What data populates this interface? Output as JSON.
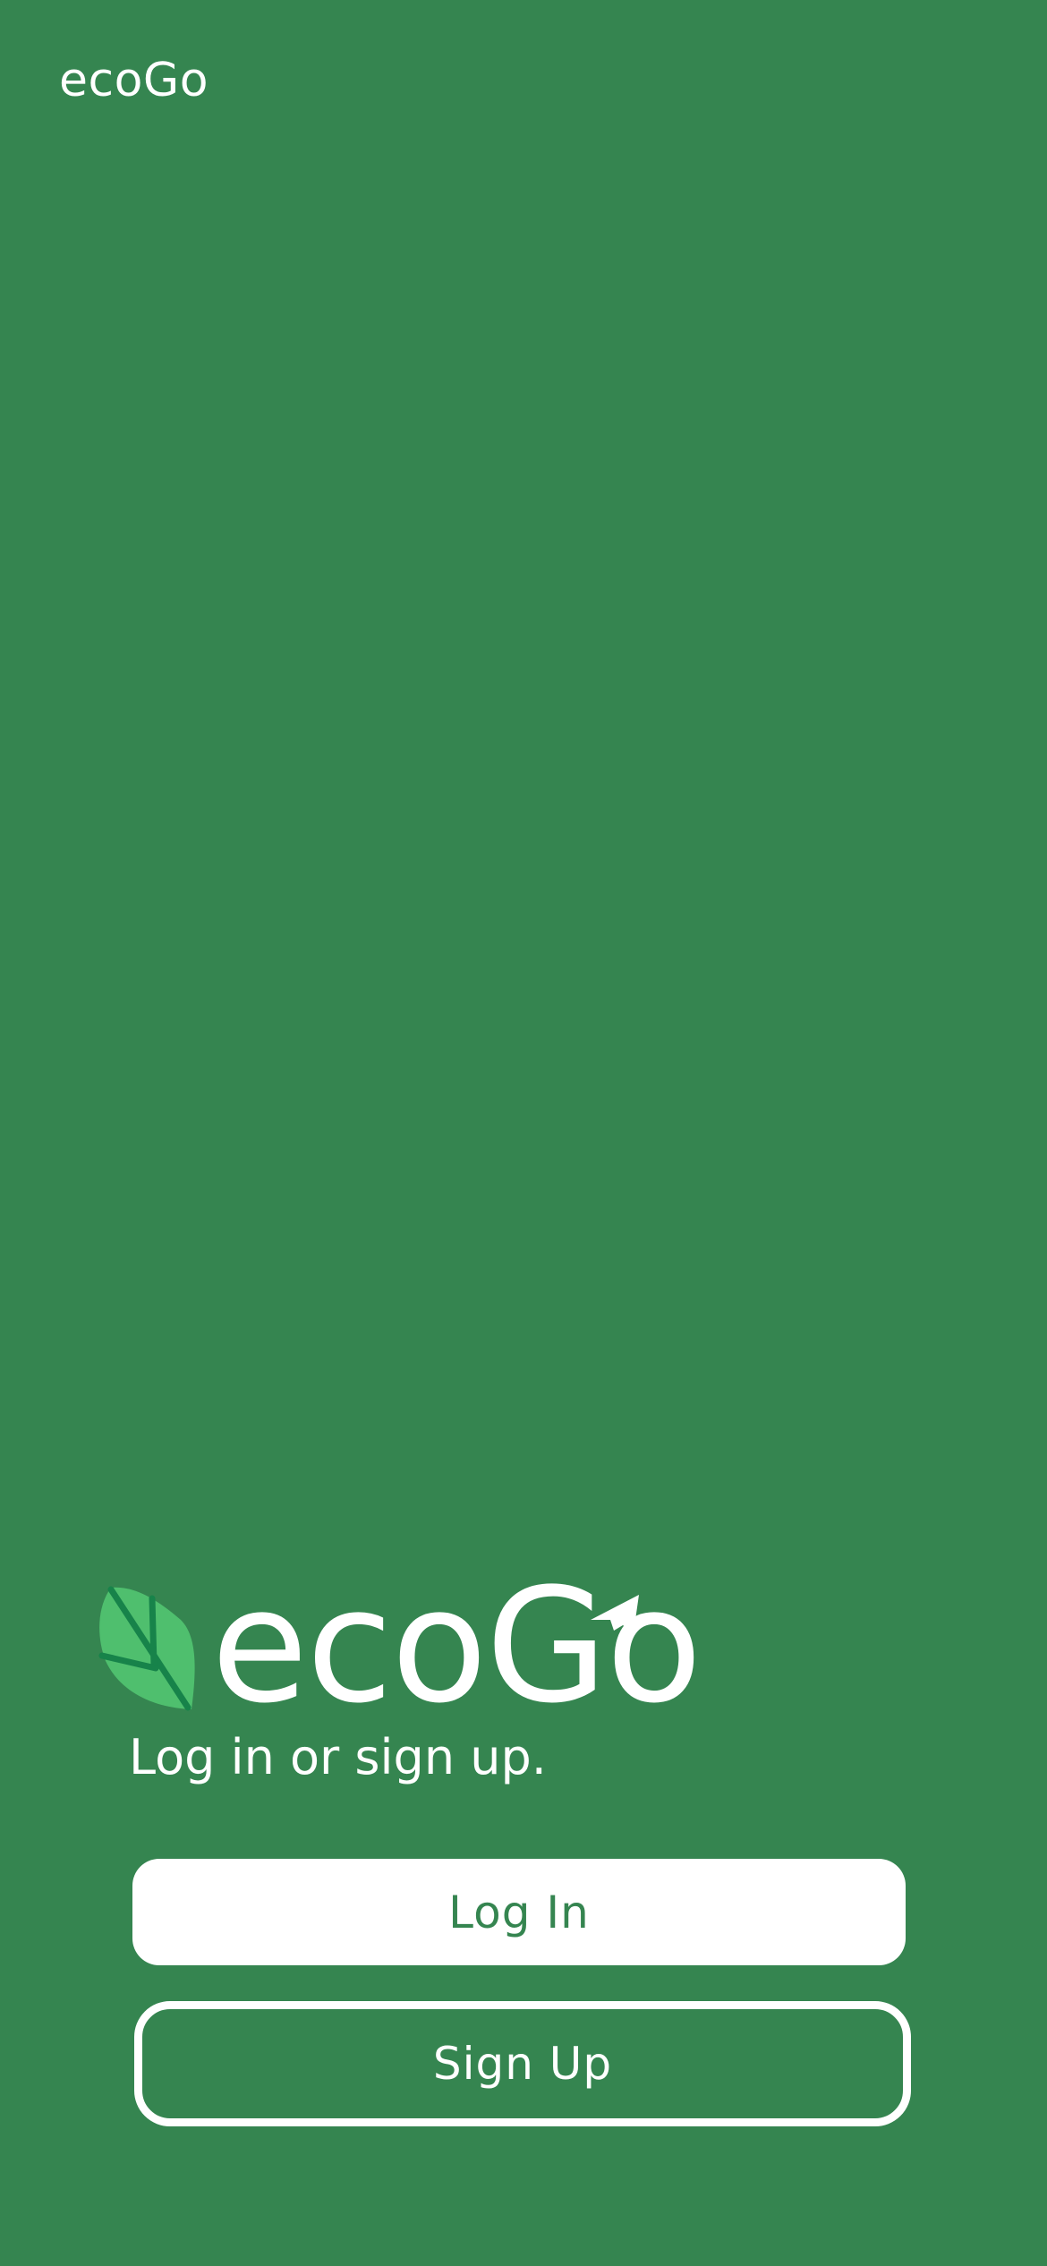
{
  "app": {
    "title": "ecoGo"
  },
  "logo": {
    "wordmark": "ecoGo",
    "leaf_icon": "leaf-icon",
    "arrow_icon": "arrow-icon"
  },
  "tagline": "Log in or sign up.",
  "buttons": {
    "login_label": "Log In",
    "signup_label": "Sign Up"
  },
  "colors": {
    "background": "#358550",
    "leaf_light": "#4FBF6E",
    "leaf_vein": "#17834A",
    "white": "#FFFFFF"
  }
}
